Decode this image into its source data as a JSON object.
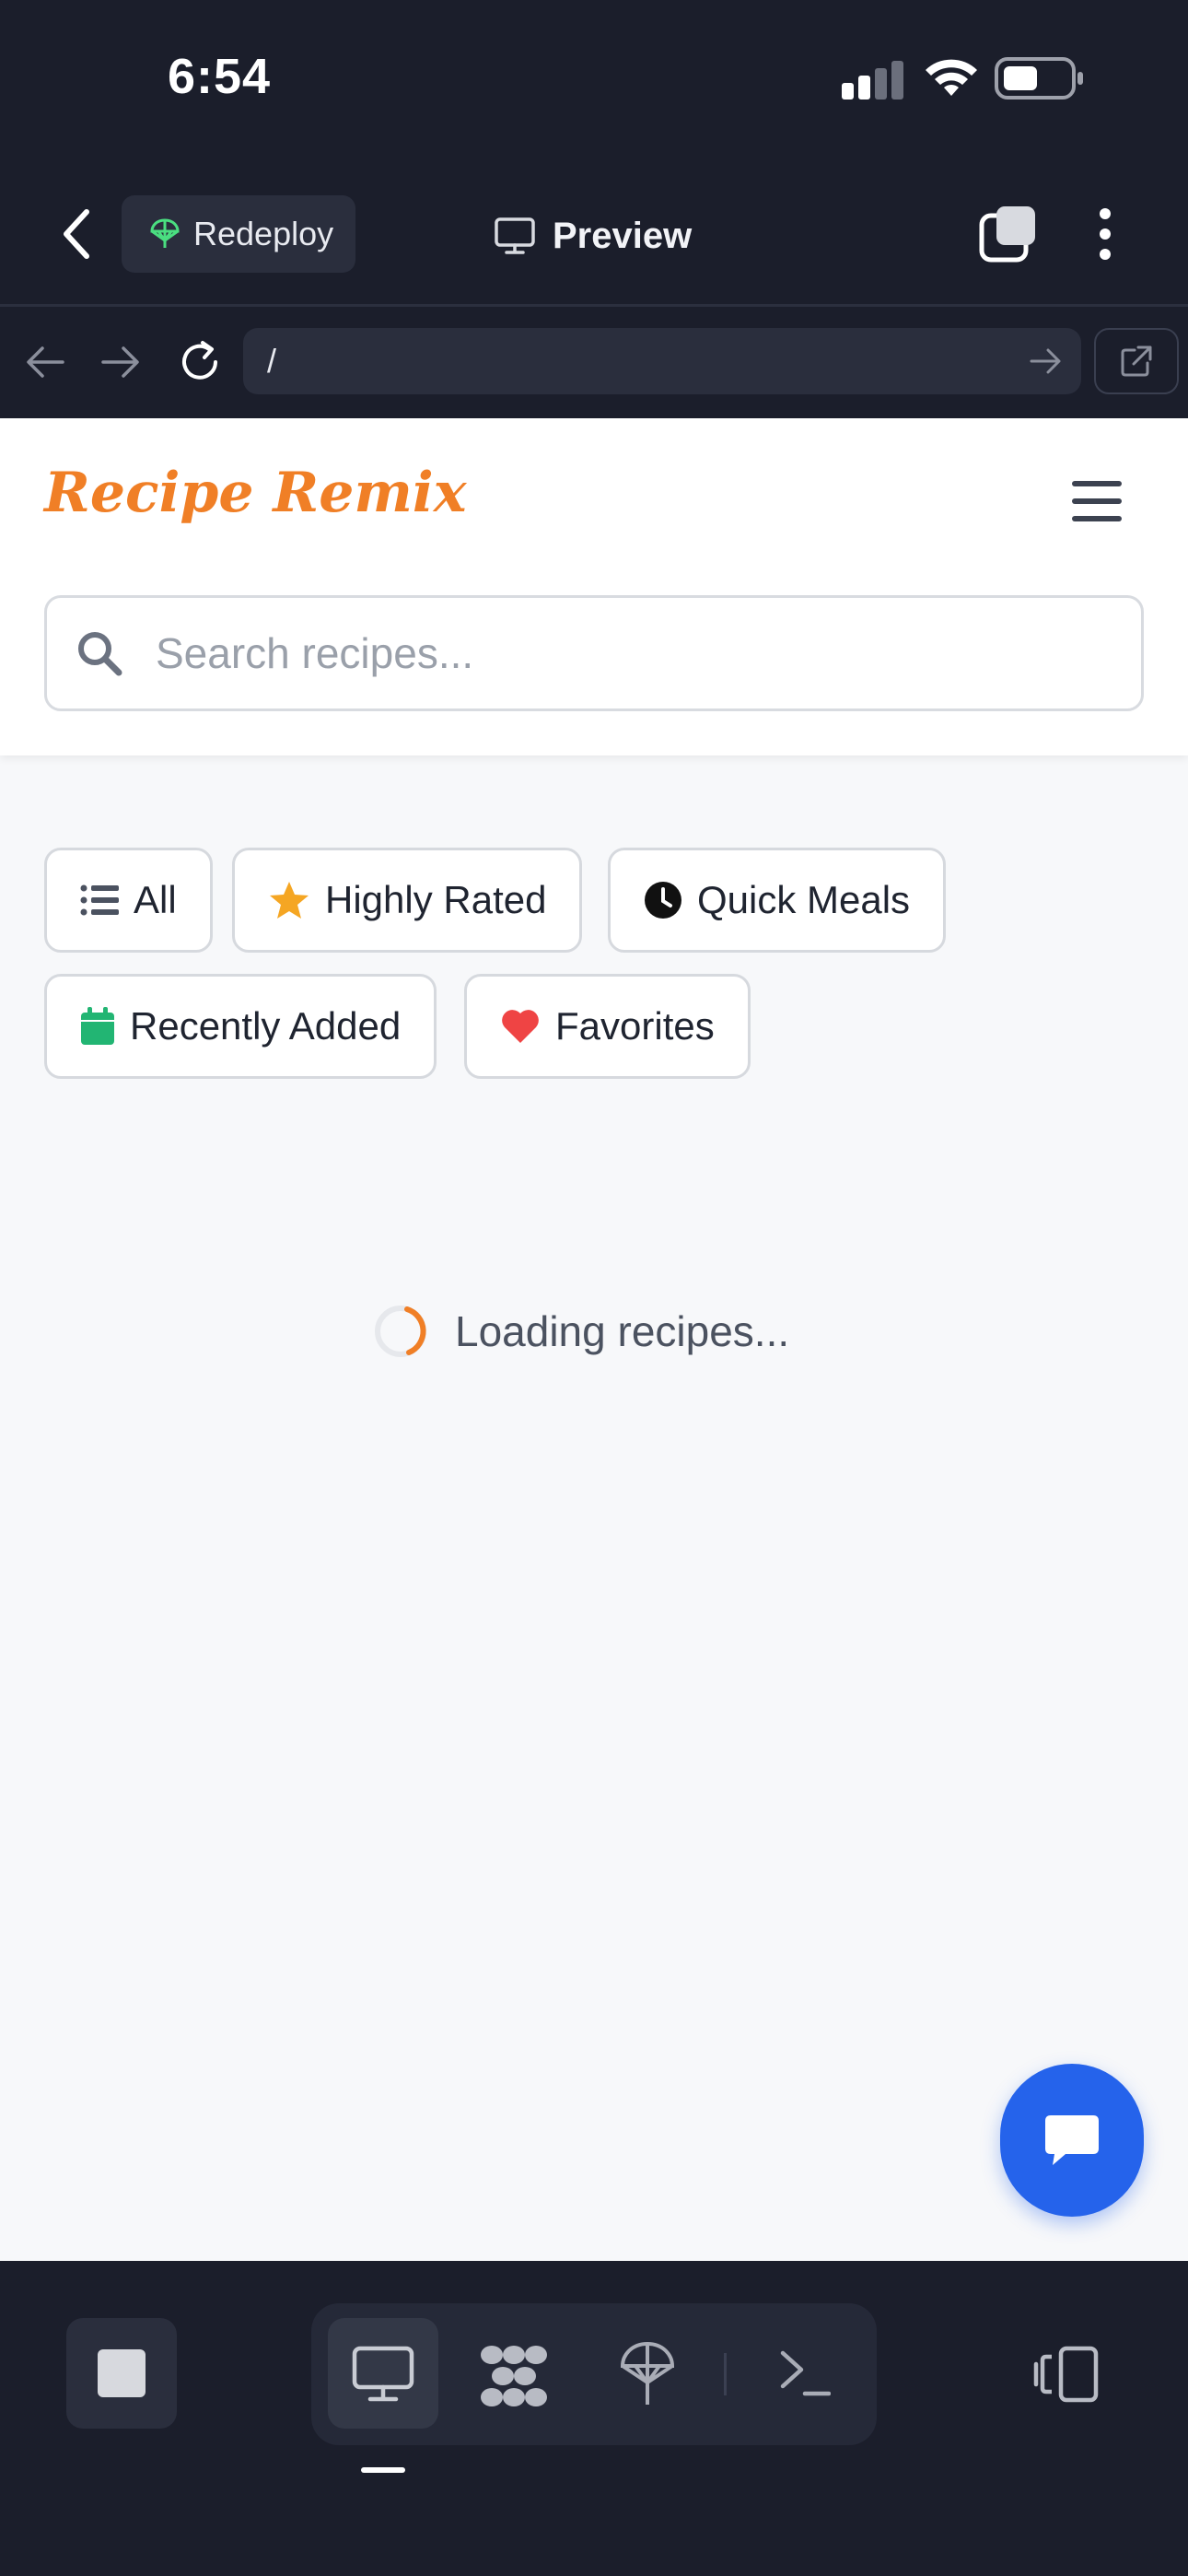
{
  "status_bar": {
    "time": "6:54"
  },
  "app_bar": {
    "redeploy_label": "Redeploy",
    "title": "Preview"
  },
  "browser": {
    "url": "/"
  },
  "site": {
    "logo": "Recipe Remix",
    "search": {
      "placeholder": "Search recipes...",
      "value": ""
    },
    "filters": [
      {
        "label": "All",
        "icon": "list-icon"
      },
      {
        "label": "Highly Rated",
        "icon": "star-icon"
      },
      {
        "label": "Quick Meals",
        "icon": "clock-icon"
      },
      {
        "label": "Recently Added",
        "icon": "calendar-icon"
      },
      {
        "label": "Favorites",
        "icon": "heart-icon"
      }
    ],
    "loading_text": "Loading recipes..."
  },
  "colors": {
    "brand": "#f07f26",
    "chrome_bg": "#1b1e2b",
    "fab": "#2563eb",
    "star": "#f5a623",
    "calendar": "#22b573",
    "heart": "#ef4444",
    "redeploy_icon": "#4ade80"
  },
  "bottom_toolbar": {
    "icons": [
      "stop-icon",
      "desktop-icon",
      "integrations-icon",
      "deploy-icon",
      "terminal-icon",
      "devices-icon"
    ]
  }
}
